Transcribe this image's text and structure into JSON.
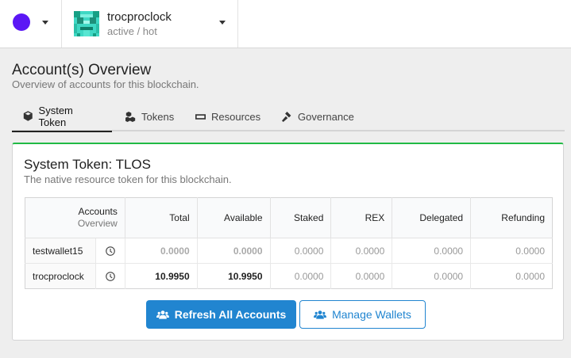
{
  "account": {
    "name": "trocproclock",
    "authority": "active / hot"
  },
  "header": {
    "title": "Account(s) Overview",
    "subtitle": "Overview of accounts for this blockchain."
  },
  "tabs": [
    {
      "label": "System Token",
      "icon": "cube-icon",
      "active": true
    },
    {
      "label": "Tokens",
      "icon": "cubes-icon",
      "active": false
    },
    {
      "label": "Resources",
      "icon": "microchip-icon",
      "active": false
    },
    {
      "label": "Governance",
      "icon": "gavel-icon",
      "active": false
    }
  ],
  "segment": {
    "title": "System Token: TLOS",
    "subtitle": "The native resource token for this blockchain."
  },
  "table": {
    "account_header_line1": "Accounts",
    "account_header_line2": "Overview",
    "columns": [
      "Total",
      "Available",
      "Staked",
      "REX",
      "Delegated",
      "Refunding"
    ],
    "rows": [
      {
        "account": "testwallet15",
        "total": "0.0000",
        "available": "0.0000",
        "staked": "0.0000",
        "rex": "0.0000",
        "delegated": "0.0000",
        "refunding": "0.0000"
      },
      {
        "account": "trocproclock",
        "total": "10.9950",
        "available": "10.9950",
        "staked": "0.0000",
        "rex": "0.0000",
        "delegated": "0.0000",
        "refunding": "0.0000"
      }
    ]
  },
  "buttons": {
    "refresh": "Refresh All Accounts",
    "manage": "Manage Wallets"
  },
  "colors": {
    "chain": "#5b17f5",
    "accent": "#2185d0",
    "success": "#21ba45"
  }
}
